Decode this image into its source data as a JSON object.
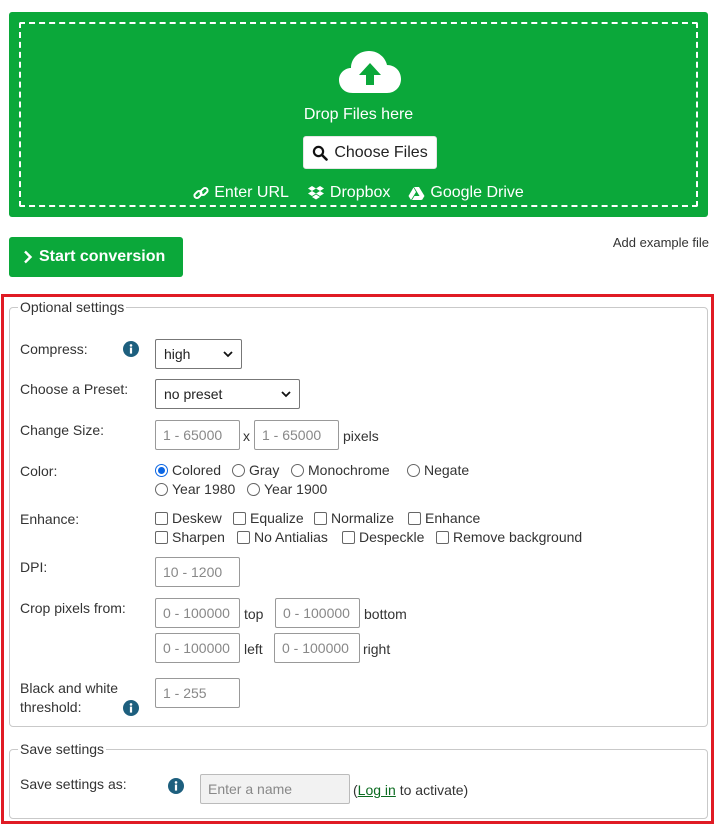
{
  "upload": {
    "drop_text": "Drop Files here",
    "choose_label": "Choose Files",
    "enter_url": "Enter URL",
    "dropbox": "Dropbox",
    "google_drive": "Google Drive"
  },
  "actions": {
    "start_label": "Start conversion",
    "add_example": "Add example file"
  },
  "optional": {
    "legend": "Optional settings",
    "compress": {
      "label": "Compress:",
      "value": "high"
    },
    "preset": {
      "label": "Choose a Preset:",
      "value": "no preset"
    },
    "size": {
      "label": "Change Size:",
      "width_placeholder": "1 - 65000",
      "height_placeholder": "1 - 65000",
      "x": "x",
      "unit": "pixels"
    },
    "color": {
      "label": "Color:",
      "options": [
        "Colored",
        "Gray",
        "Monochrome",
        "Negate",
        "Year 1980",
        "Year 1900"
      ],
      "selected": "Colored"
    },
    "enhance": {
      "label": "Enhance:",
      "options": [
        "Deskew",
        "Equalize",
        "Normalize",
        "Enhance",
        "Sharpen",
        "No Antialias",
        "Despeckle",
        "Remove background"
      ]
    },
    "dpi": {
      "label": "DPI:",
      "placeholder": "10 - 1200"
    },
    "crop": {
      "label": "Crop pixels from:",
      "placeholder": "0 - 100000",
      "top": "top",
      "bottom": "bottom",
      "left": "left",
      "right": "right"
    },
    "threshold": {
      "label_line1": "Black and white",
      "label_line2": "threshold:",
      "placeholder": "1 - 255"
    }
  },
  "save": {
    "legend": "Save settings",
    "label": "Save settings as:",
    "placeholder": "Enter a name",
    "paren_open": "(",
    "login": "Log in",
    "suffix": " to activate)"
  },
  "colors": {
    "brand_green": "#0ba83a",
    "highlight_red": "#e01b24",
    "info_blue": "#1d5f7e",
    "radio_blue": "#0b66e4"
  },
  "icons": [
    "cloud-upload-icon",
    "search-icon",
    "link-icon",
    "dropbox-icon",
    "google-drive-icon",
    "chevron-right-icon",
    "info-icon",
    "chevron-down-icon"
  ]
}
